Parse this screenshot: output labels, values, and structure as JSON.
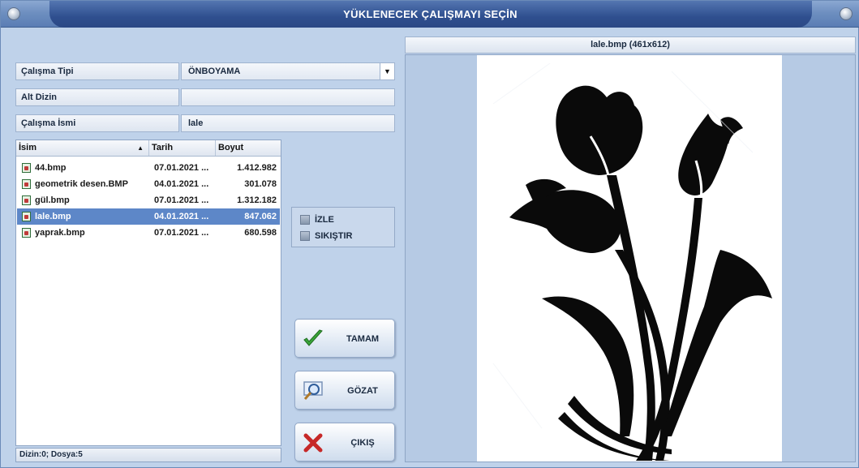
{
  "window": {
    "title": "YÜKLENECEK ÇALIŞMAYI SEÇİN"
  },
  "form": {
    "study_type_label": "Çalışma Tipi",
    "study_type_value": "ÖNBOYAMA",
    "subdir_label": "Alt Dizin",
    "subdir_value": "",
    "study_name_label": "Çalışma İsmi",
    "study_name_value": "lale"
  },
  "filelist": {
    "columns": [
      "İsim",
      "Tarih",
      "Boyut"
    ],
    "rows": [
      {
        "name": "44.bmp",
        "date": "07.01.2021 ...",
        "size": "1.412.982"
      },
      {
        "name": "geometrik desen.BMP",
        "date": "04.01.2021 ...",
        "size": "301.078"
      },
      {
        "name": "gül.bmp",
        "date": "07.01.2021 ...",
        "size": "1.312.182"
      },
      {
        "name": "lale.bmp",
        "date": "04.01.2021 ...",
        "size": "847.062",
        "selected": true
      },
      {
        "name": "yaprak.bmp",
        "date": "07.01.2021 ...",
        "size": "680.598"
      }
    ],
    "status": "Dizin:0; Dosya:5"
  },
  "options": {
    "izle": "İZLE",
    "sikistir": "SIKIŞTIR"
  },
  "buttons": {
    "ok": "TAMAM",
    "browse": "GÖZAT",
    "exit": "ÇIKIŞ"
  },
  "preview": {
    "title": "lale.bmp (461x612)"
  },
  "colors": {
    "accent": "#2f4f8f",
    "selection": "#5d87c8",
    "ok_check": "#3aa53a",
    "exit_x": "#c62828"
  }
}
